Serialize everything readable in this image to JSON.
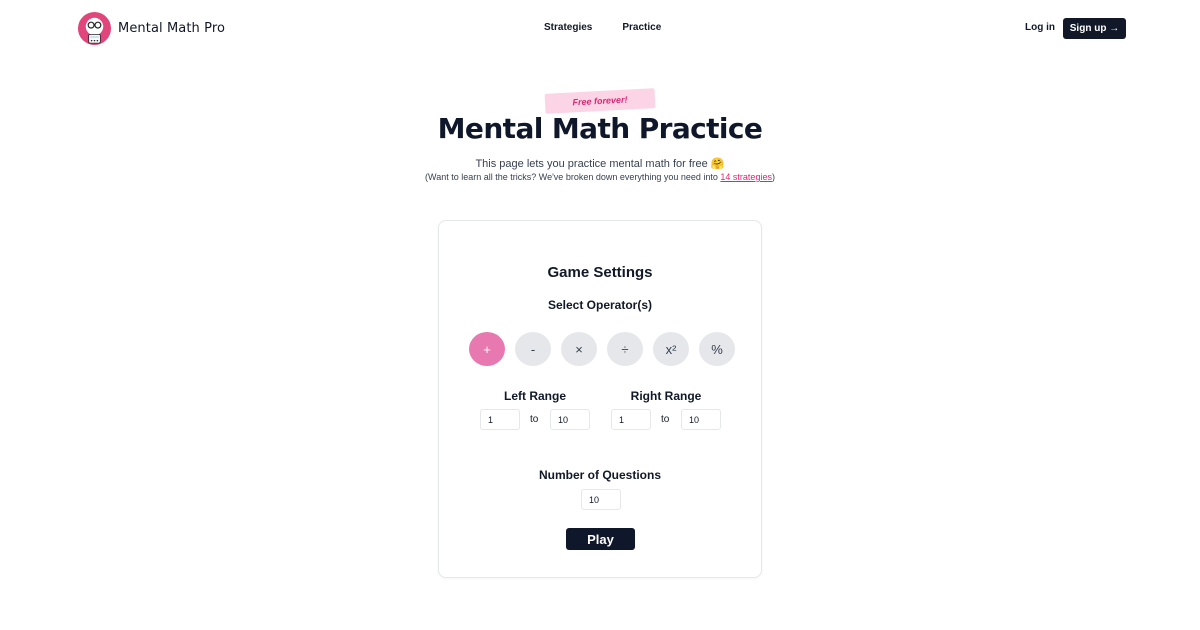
{
  "header": {
    "brand_name": "Mental Math Pro",
    "nav": [
      "Strategies",
      "Practice"
    ],
    "login_label": "Log in",
    "signup_label": "Sign up →"
  },
  "hero": {
    "badge": "Free forever!",
    "title": "Mental Math Practice",
    "subtitle": "This page lets you practice mental math for free 🤗",
    "note_prefix": "(Want to learn all the tricks? We've broken down everything you need into ",
    "note_link": "14 strategies",
    "note_suffix": ")"
  },
  "settings": {
    "title": "Game Settings",
    "operators_label": "Select Operator(s)",
    "operators": [
      {
        "symbol": "+",
        "selected": true
      },
      {
        "symbol": "-",
        "selected": false
      },
      {
        "symbol": "×",
        "selected": false
      },
      {
        "symbol": "÷",
        "selected": false
      },
      {
        "symbol": "x²",
        "selected": false
      },
      {
        "symbol": "%",
        "selected": false
      }
    ],
    "left_range": {
      "label": "Left Range",
      "from": "1",
      "to_label": "to",
      "to": "10"
    },
    "right_range": {
      "label": "Right Range",
      "from": "1",
      "to_label": "to",
      "to": "10"
    },
    "questions": {
      "label": "Number of Questions",
      "value": "10"
    },
    "play_label": "Play"
  },
  "colors": {
    "accent": "#e879b0",
    "dark": "#0f172a",
    "badge_bg": "#fbd5e6",
    "badge_text": "#db2777"
  }
}
